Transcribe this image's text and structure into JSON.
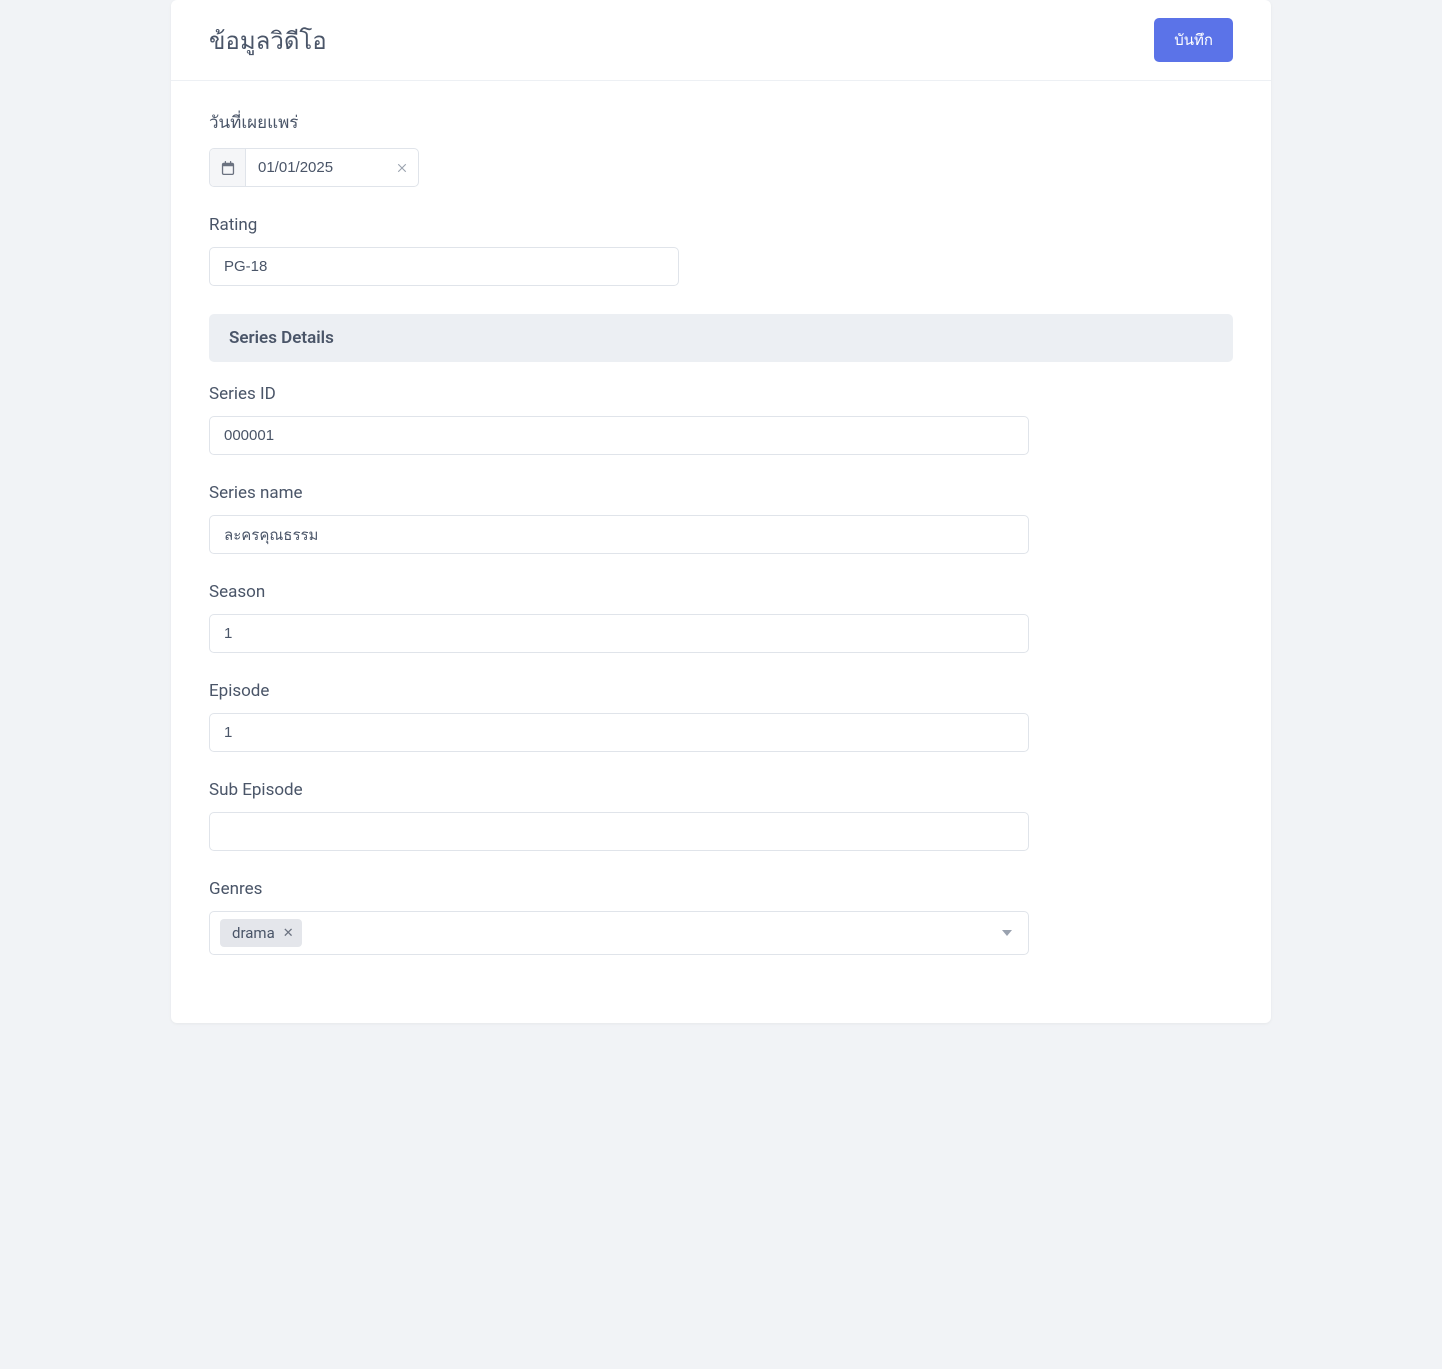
{
  "header": {
    "title": "ข้อมูลวิดีโอ",
    "save_label": "บันทึก"
  },
  "publish_date": {
    "label": "วันที่เผยแพร่",
    "value": "01/01/2025"
  },
  "rating": {
    "label": "Rating",
    "value": "PG-18"
  },
  "series_section": {
    "heading": "Series Details",
    "series_id": {
      "label": "Series ID",
      "value": "000001"
    },
    "series_name": {
      "label": "Series name",
      "value": "ละครคุณธรรม"
    },
    "season": {
      "label": "Season",
      "value": "1"
    },
    "episode": {
      "label": "Episode",
      "value": "1"
    },
    "sub_episode": {
      "label": "Sub Episode",
      "value": ""
    },
    "genres": {
      "label": "Genres",
      "tags": [
        "drama"
      ]
    }
  }
}
